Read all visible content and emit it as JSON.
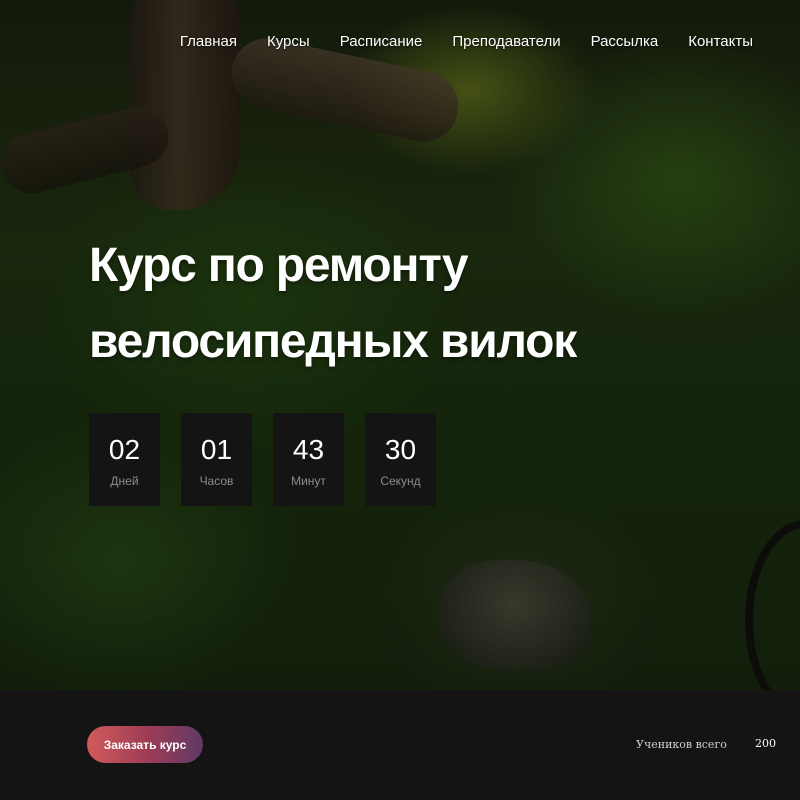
{
  "nav": {
    "items": [
      {
        "label": "Главная"
      },
      {
        "label": "Курсы"
      },
      {
        "label": "Расписание"
      },
      {
        "label": "Преподаватели"
      },
      {
        "label": "Рассылка"
      },
      {
        "label": "Контакты"
      }
    ]
  },
  "hero": {
    "title_line1": "Курс по ремонту",
    "title_line2": "велосипедных вилок"
  },
  "countdown": [
    {
      "value": "02",
      "label": "Дней"
    },
    {
      "value": "01",
      "label": "Часов"
    },
    {
      "value": "43",
      "label": "Минут"
    },
    {
      "value": "30",
      "label": "Секунд"
    }
  ],
  "bottom_bar": {
    "order_button_label": "Заказать курс",
    "students_label": "Учеников всего",
    "students_count": "200"
  },
  "colors": {
    "button_gradient_start": "#d25a5a",
    "button_gradient_end": "#5e3a66",
    "timer_background": "#141414",
    "bottom_background": "#141414"
  }
}
